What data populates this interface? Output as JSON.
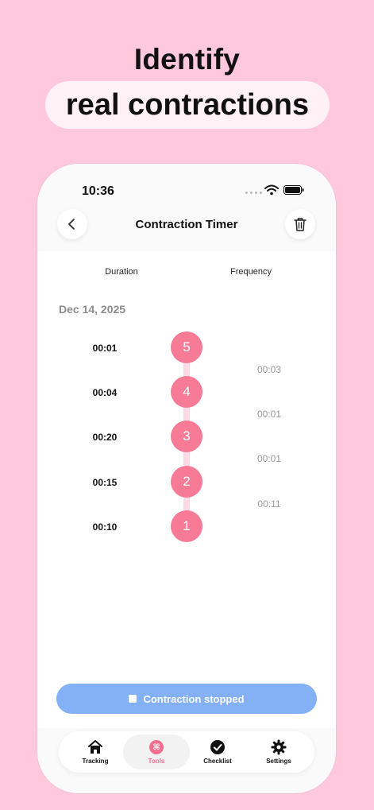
{
  "hero": {
    "title_line1": "Identify",
    "title_line2": "real contractions"
  },
  "status_bar": {
    "time": "10:36"
  },
  "header": {
    "title": "Contraction Timer",
    "back_icon": "chevron-left-icon",
    "delete_icon": "trash-icon"
  },
  "columns": {
    "duration": "Duration",
    "frequency": "Frequency"
  },
  "date": "Dec 14, 2025",
  "timeline": [
    {
      "number": "5",
      "duration": "00:01",
      "frequency": "00:03"
    },
    {
      "number": "4",
      "duration": "00:04",
      "frequency": "00:01"
    },
    {
      "number": "3",
      "duration": "00:20",
      "frequency": "00:01"
    },
    {
      "number": "2",
      "duration": "00:15",
      "frequency": "00:11"
    },
    {
      "number": "1",
      "duration": "00:10",
      "frequency": ""
    }
  ],
  "action": {
    "label": "Contraction stopped"
  },
  "tabs": [
    {
      "label": "Tracking",
      "icon": "home-icon",
      "active": false
    },
    {
      "label": "Tools",
      "icon": "tools-icon",
      "active": true
    },
    {
      "label": "Checklist",
      "icon": "check-circle-icon",
      "active": false
    },
    {
      "label": "Settings",
      "icon": "gear-icon",
      "active": false
    }
  ],
  "colors": {
    "background": "#ffc8dc",
    "accent_pink": "#f77b97",
    "button_blue": "#84b0f5"
  }
}
